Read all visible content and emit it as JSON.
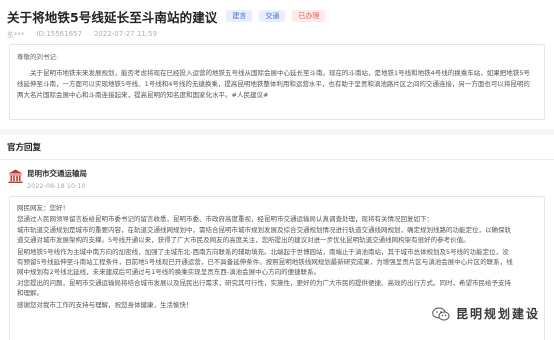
{
  "header": {
    "title": "关于将地铁5号线延长至斗南站的建议",
    "tags": [
      "建言",
      "交通",
      "已办理"
    ],
    "author": "东***",
    "id_text": "ID:15561657",
    "datetime": "2022-07-27 11:59"
  },
  "letter": {
    "greeting": "尊敬的刘书记:",
    "body": "关于昆明市地铁未来发展规划，能否考虑将现在已经投入运营的地铁五号线从国际会展中心延长至斗南。现在的斗南站，是地铁1号线和地铁4号线的换乘车站，如果把地铁5号线延伸至斗南，一方面可以实现地铁5号线、1号线和4号线的无缝换乘，提高昆明地铁整体利用和运营水平，也有助于呈贡和滇池路片区之间的交通连接，另一方面也可以将昆明的两大名片国际会展中心和斗南连接起来，提高昆明的知名度和国家化水平。#人民建议#"
  },
  "reply_section": {
    "title": "官方回复"
  },
  "reply": {
    "org_name": "昆明市交通运输局",
    "time": "2022-08-18 10:10",
    "greeting": "网民网友：您好！",
    "lines": [
      "您通过人民网领导留言板给昆明市委书记的留言收悉，昆明市委、市政府高度重视，经昆明市交通运输局认真调查处理，现将有关情况回复如下：",
      "城市轨道交通规划是城市的重要内容，在轨道交通线网规划中，需结合昆明市城市规划发展及综合交通规划情况进行轨道交通线网规划，确定规划线路的功能定位，以确保轨",
      "道交通对城市发展架构的支撑。5号线开通以来，获得了广大市民及网友的高度关注，您所提出的建议对进一步优化昆明轨道交通线网构架有很好的参考价值。",
      "昆明地铁5号线作为主城中南方向的加密线，加强了主城东北-西南方向联系的辅助填充。北端起于世博园站，南端止于滇池南站，其于城市总体规划及5号线的功能定位，没",
      "有预留5号线延伸至斗南站工程条件，目前地5号线现已开通运营，已不具备延伸条件。按照昆明地铁线网规划最新研究成果，为增强呈贡片区与滇池会展中心片区的联系，线",
      "网中规划有2号线北延线，未来建成后可通过与1号线的换乘实现呈贡东西-滇池会展中心方向的便捷联系。",
      "对您提出的问题，昆明市交通运输局将结合城市发展以及昆民出行需求，研究其可行性，实施性，更好的为广大市民的提供便捷、高效的出行方式。同时，希望市民给予支持",
      "和理解。",
      "感谢您对我市工作的支持与理解，祝您身体健康，生活愉快！"
    ]
  },
  "watermark": {
    "text": "昆明规划建设",
    "icon": "wechat-icon"
  },
  "colors": {
    "tag_blue_bg": "#e8eefc",
    "tag_blue_text": "#4a6fd1",
    "tag_red_bg": "#fdeaea",
    "tag_red_text": "#e0605a",
    "org_icon": "#c0392b"
  }
}
